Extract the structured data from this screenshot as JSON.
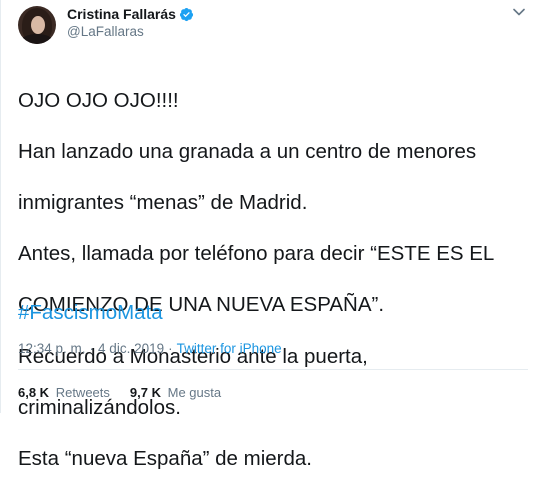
{
  "author": {
    "display_name": "Cristina Fallarás",
    "handle": "@LaFallaras",
    "verified": true,
    "avatar_icon": "avatar-photo"
  },
  "tweet": {
    "text_lines": [
      "OJO OJO OJO!!!!",
      "Han lanzado una granada a un centro de menores",
      "inmigrantes “menas” de Madrid.",
      "Antes, llamada por teléfono para decir “ESTE ES EL",
      "COMIENZO DE UNA NUEVA ESPAÑA”.",
      "Recuerdo a Monasterio ante la puerta,",
      "criminalizándolos.",
      "Esta “nueva España” de mierda."
    ],
    "hashtag": "#FascismoMata"
  },
  "meta": {
    "time": "12:34 p. m.",
    "separator": "·",
    "date": "4 dic. 2019",
    "source": "Twitter for iPhone"
  },
  "stats": {
    "retweets_count": "6,8 K",
    "retweets_label": "Retweets",
    "likes_count": "9,7 K",
    "likes_label": "Me gusta"
  },
  "colors": {
    "link": "#1b95e0",
    "verified": "#1da1f2",
    "secondary_text": "#657786",
    "primary_text": "#14171a",
    "divider": "#e6ecf0"
  }
}
